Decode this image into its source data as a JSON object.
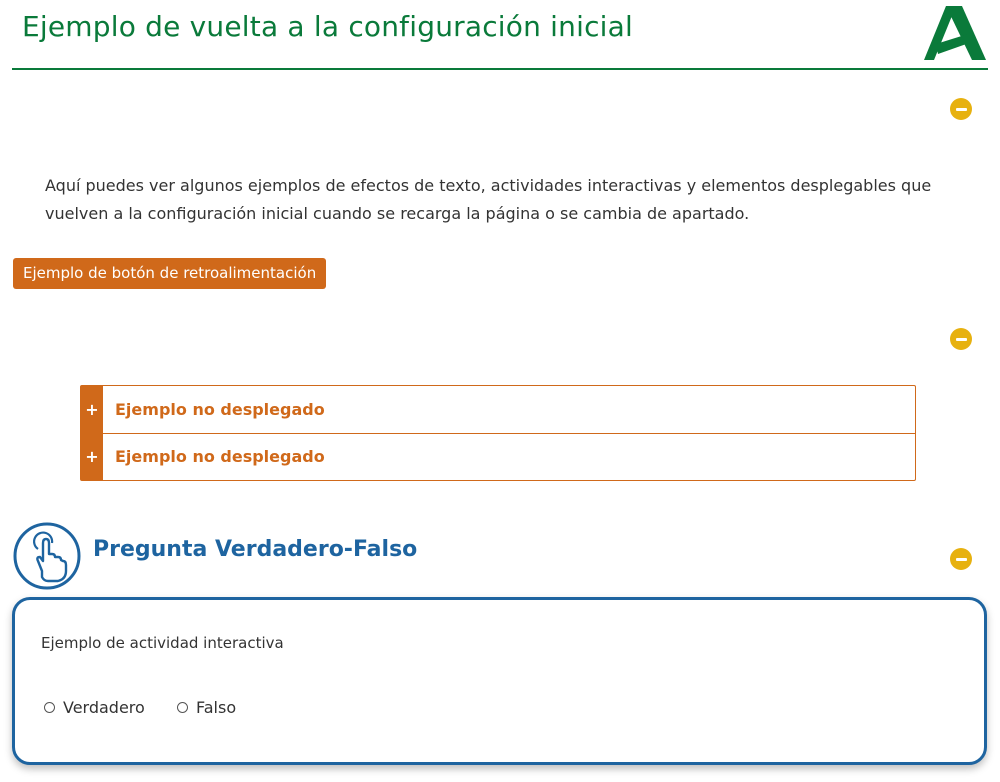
{
  "header": {
    "title": "Ejemplo de vuelta a la configuración inicial",
    "logo_icon": "junta-andalucia-logo",
    "accent_color": "#0a7a3a"
  },
  "intro": {
    "text": "Aquí puedes ver algunos ejemplos de efectos de texto, actividades interactivas y elementos desplegables que vuelven a la configuración inicial cuando se recarga la página o se cambia de apartado."
  },
  "feedback_button": {
    "label": "Ejemplo de botón de retroalimentación",
    "color": "#d0691a"
  },
  "collapse_buttons": {
    "icon": "minus-circle-icon",
    "color": "#e7b10f"
  },
  "accordion": {
    "items": [
      {
        "icon": "plus-icon",
        "label": "Ejemplo no desplegado"
      },
      {
        "icon": "plus-icon",
        "label": "Ejemplo no desplegado"
      }
    ]
  },
  "quiz": {
    "icon": "tap-hand-icon",
    "title": "Pregunta Verdadero-Falso",
    "question": "Ejemplo de actividad interactiva",
    "options": [
      {
        "label": "Verdadero",
        "checked": false
      },
      {
        "label": "Falso",
        "checked": false
      }
    ],
    "color": "#1e64a0"
  }
}
